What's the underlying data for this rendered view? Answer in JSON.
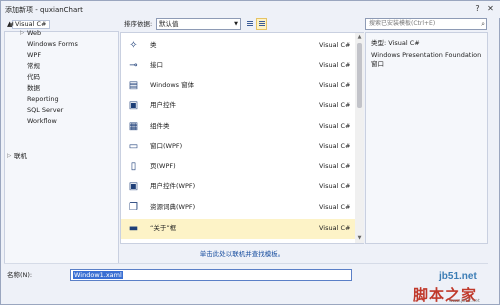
{
  "window": {
    "title": "添加新项 - quxianChart"
  },
  "titlebar": {
    "help_glyph": "?",
    "close_glyph": "✕"
  },
  "sidebar": {
    "header": "▲ 已安装",
    "items": [
      {
        "label": "Visual C#",
        "expanded": true,
        "arrow": "◢"
      },
      {
        "label": "Web",
        "arrow": "▷"
      },
      {
        "label": "Windows Forms"
      },
      {
        "label": "WPF"
      },
      {
        "label": "常规"
      },
      {
        "label": "代码"
      },
      {
        "label": "数据"
      },
      {
        "label": "Reporting"
      },
      {
        "label": "SQL Server"
      },
      {
        "label": "Workflow"
      }
    ],
    "online": {
      "label": "联机",
      "arrow": "▷"
    }
  },
  "toolbar": {
    "sort_label": "排序依据:",
    "sort_value": "默认值",
    "search_placeholder": "搜索已安装模板(Ctrl+E)"
  },
  "templates": [
    {
      "name": "类",
      "lang": "Visual C#",
      "icon": "class-icon",
      "glyph": "✧"
    },
    {
      "name": "接口",
      "lang": "Visual C#",
      "icon": "interface-icon",
      "glyph": "⊸"
    },
    {
      "name": "Windows 窗体",
      "lang": "Visual C#",
      "icon": "windows-form-icon",
      "glyph": "▤"
    },
    {
      "name": "用户控件",
      "lang": "Visual C#",
      "icon": "user-control-icon",
      "glyph": "▣"
    },
    {
      "name": "组件类",
      "lang": "Visual C#",
      "icon": "component-class-icon",
      "glyph": "▦"
    },
    {
      "name": "窗口(WPF)",
      "lang": "Visual C#",
      "icon": "wpf-window-icon",
      "glyph": "▭"
    },
    {
      "name": "页(WPF)",
      "lang": "Visual C#",
      "icon": "wpf-page-icon",
      "glyph": "▯"
    },
    {
      "name": "用户控件(WPF)",
      "lang": "Visual C#",
      "icon": "wpf-user-control-icon",
      "glyph": "▣"
    },
    {
      "name": "资源词典(WPF)",
      "lang": "Visual C#",
      "icon": "resource-dictionary-icon",
      "glyph": "❐"
    },
    {
      "name": "“关于”框",
      "lang": "Visual C#",
      "icon": "about-box-icon",
      "glyph": "▬",
      "selected": true
    }
  ],
  "online_link": "单击此处以联机并查找模板。",
  "details": {
    "type_line": "类型:  Visual C#",
    "description": "Windows Presentation Foundation 窗口"
  },
  "footer": {
    "name_label": "名称(N):",
    "name_value": "Window1.xaml"
  },
  "watermark": {
    "site": "jb51.net",
    "brand": "脚本之家",
    "url": "www.jb51.net"
  }
}
